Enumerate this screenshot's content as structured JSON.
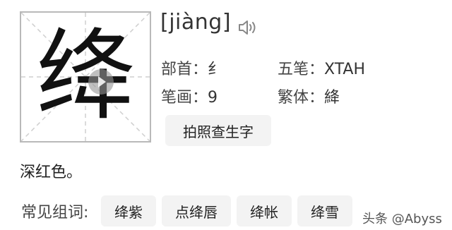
{
  "character": "绛",
  "pinyin": "[jiàng]",
  "info": {
    "radical_label": "部首：",
    "radical_value": "纟",
    "wubi_label": "五笔：",
    "wubi_value": "XTAH",
    "strokes_label": "笔画：",
    "strokes_value": "9",
    "traditional_label": "繁体：",
    "traditional_value": "絳"
  },
  "photo_search_label": "拍照查生字",
  "definition": "深红色。",
  "common_words": {
    "label": "常见组词:",
    "items": [
      "绛紫",
      "点绛唇",
      "绛帐",
      "绛雪"
    ]
  },
  "watermark": "头条 @Abyss",
  "icons": [
    "speaker-icon",
    "play-icon"
  ]
}
